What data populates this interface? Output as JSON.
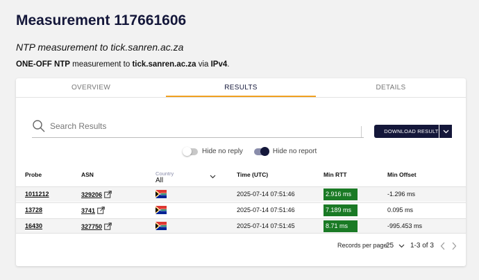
{
  "page": {
    "title": "Measurement 117661606",
    "subtitle": "NTP measurement to tick.sanren.ac.za",
    "description": {
      "prefix": "ONE-OFF NTP",
      "middle": " measurement to ",
      "target": "tick.sanren.ac.za",
      "via": " via ",
      "protocol": "IPv4",
      "suffix": "."
    }
  },
  "tabs": [
    {
      "label": "OVERVIEW",
      "active": false
    },
    {
      "label": "RESULTS",
      "active": true
    },
    {
      "label": "DETAILS",
      "active": false
    }
  ],
  "search": {
    "placeholder": "Search Results",
    "value": ""
  },
  "download": {
    "label": "DOWNLOAD RESULTS"
  },
  "toggles": [
    {
      "label": "Hide no reply",
      "on": false
    },
    {
      "label": "Hide no report",
      "on": true
    }
  ],
  "table": {
    "headers": {
      "probe": "Probe",
      "asn": "ASN",
      "country_small": "Country",
      "country_value": "All",
      "time": "Time (UTC)",
      "rtt": "Min RTT",
      "offset": "Min Offset"
    },
    "rows": [
      {
        "probe": "1011212",
        "asn": "329206",
        "country_flag": "south-africa-flag",
        "time": "2025-07-14 07:51:46",
        "rtt": "2.916 ms",
        "offset": "-1.296 ms"
      },
      {
        "probe": "13728",
        "asn": "3741",
        "country_flag": "south-africa-flag",
        "time": "2025-07-14 07:51:46",
        "rtt": "7.189 ms",
        "offset": "0.095 ms"
      },
      {
        "probe": "16430",
        "asn": "327750",
        "country_flag": "south-africa-flag",
        "time": "2025-07-14 07:51:45",
        "rtt": "8.71 ms",
        "offset": "-995.453 ms"
      }
    ]
  },
  "pagination": {
    "records_label": "Records per page:",
    "per_page": "25",
    "range": "1-3 of 3"
  },
  "colors": {
    "brand": "#14173a",
    "tab_accent": "#f0a020",
    "rtt_good": "#1a7a25"
  }
}
